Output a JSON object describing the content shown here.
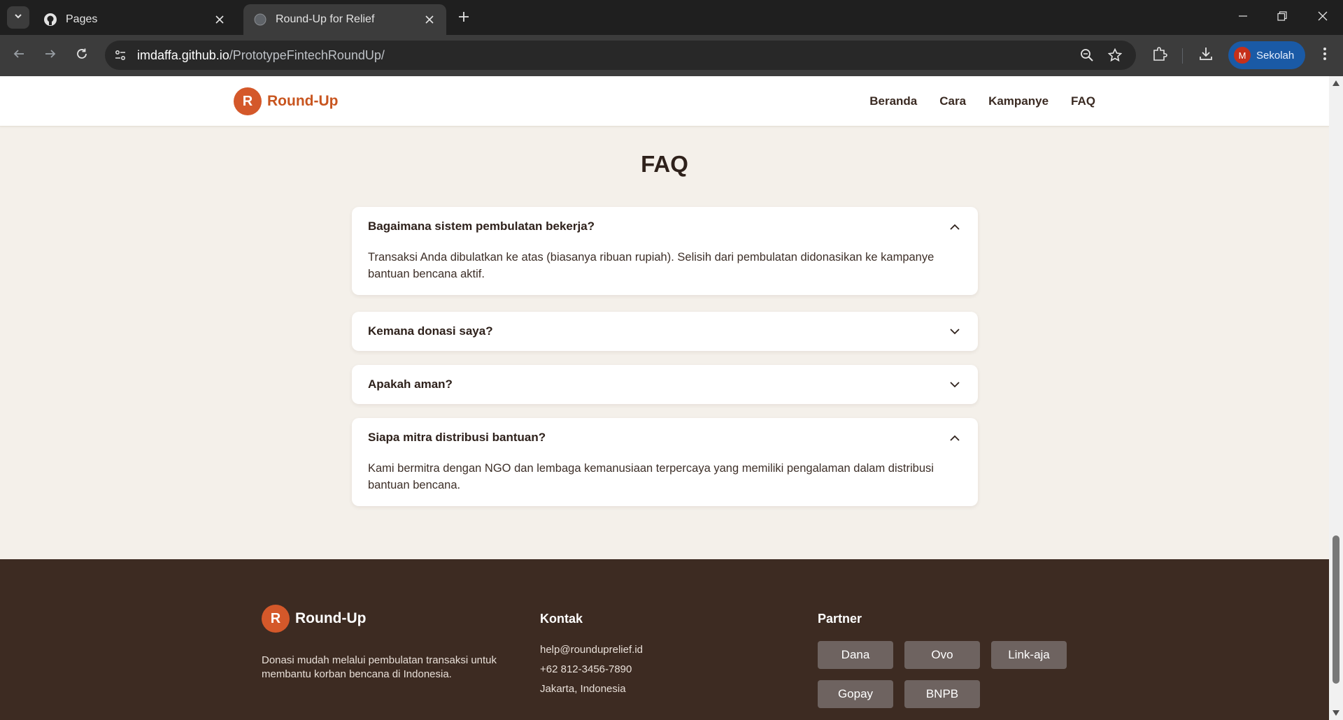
{
  "browser": {
    "tabs": [
      {
        "title": "Pages",
        "icon": "github-icon"
      },
      {
        "title": "Round-Up for Relief",
        "icon": "globe-icon"
      }
    ],
    "url_domain": "imdaffa.github.io",
    "url_path": "/PrototypeFintechRoundUp/",
    "profile_initial": "M",
    "profile_name": "Sekolah"
  },
  "header": {
    "logo_letter": "R",
    "brand": "Round-Up",
    "nav": [
      "Beranda",
      "Cara",
      "Kampanye",
      "FAQ"
    ]
  },
  "faq": {
    "title": "FAQ",
    "items": [
      {
        "question": "Bagaimana sistem pembulatan bekerja?",
        "answer": "Transaksi Anda dibulatkan ke atas (biasanya ribuan rupiah). Selisih dari pembulatan didonasikan ke kampanye bantuan bencana aktif.",
        "expanded": true
      },
      {
        "question": "Kemana donasi saya?",
        "answer": "",
        "expanded": false
      },
      {
        "question": "Apakah aman?",
        "answer": "",
        "expanded": false
      },
      {
        "question": "Siapa mitra distribusi bantuan?",
        "answer": "Kami bermitra dengan NGO dan lembaga kemanusiaan terpercaya yang memiliki pengalaman dalam distribusi bantuan bencana.",
        "expanded": true
      }
    ]
  },
  "footer": {
    "logo_letter": "R",
    "brand": "Round-Up",
    "description": "Donasi mudah melalui pembulatan transaksi untuk membantu korban bencana di Indonesia.",
    "contact_title": "Kontak",
    "contact": [
      "help@rounduprelief.id",
      "+62 812-3456-7890",
      "Jakarta, Indonesia"
    ],
    "partner_title": "Partner",
    "partners": [
      "Dana",
      "Ovo",
      "Link-aja",
      "Gopay",
      "BNPB"
    ]
  },
  "colors": {
    "accent": "#d4582a",
    "page_bg": "#f4f0ea",
    "footer_bg": "#3d2b22"
  }
}
